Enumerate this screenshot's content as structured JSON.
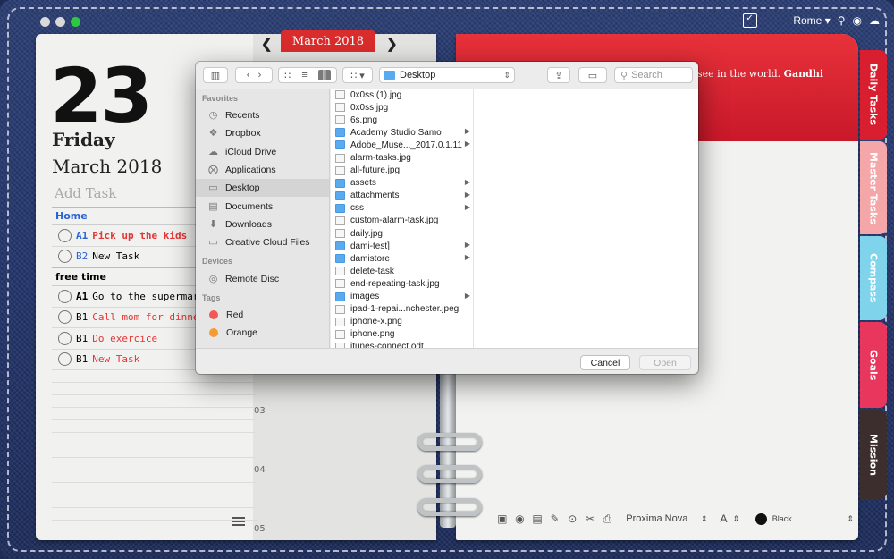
{
  "colors": {
    "accent_red": "#d92c2c",
    "home_blue": "#2864d4",
    "task_red": "#e53534"
  },
  "topbar": {
    "city": "Rome ▾",
    "icons": [
      "calendar-check-icon",
      "search-icon",
      "eye-icon",
      "cloud-icon"
    ]
  },
  "planner": {
    "day_number": "23",
    "weekday": "Friday",
    "month_year": "March 2018",
    "add_task_placeholder": "Add Task",
    "month_tab": "March 2018",
    "sections": [
      {
        "title": "Home",
        "tasks": [
          {
            "priority": "A1",
            "text": "Pick up the kids",
            "red": true
          },
          {
            "priority": "B2",
            "text": "New Task",
            "red": false
          }
        ]
      },
      {
        "title": "free time",
        "tasks": [
          {
            "priority": "A1",
            "text": "Go to the supermarke",
            "red": false
          },
          {
            "priority": "B1",
            "text": "Call mom for dinner",
            "red": true
          },
          {
            "priority": "B1",
            "text": "Do exercice",
            "red": true
          },
          {
            "priority": "B1",
            "text": "New Task",
            "red": true
          }
        ]
      }
    ],
    "hours": [
      "03",
      "04",
      "05"
    ]
  },
  "right_page": {
    "quote": "see in the world.",
    "quote_author": "Gandhi",
    "tabs": [
      "Daily Tasks",
      "Master Tasks",
      "Compass",
      "Goals",
      "Mission"
    ],
    "font_name": "Proxima Nova",
    "font_size_label": "A",
    "color_name": "Black"
  },
  "dialog": {
    "location": "Desktop",
    "search_placeholder": "Search",
    "sidebar": {
      "favorites_header": "Favorites",
      "favorites": [
        {
          "label": "Recents",
          "icon": "clock-icon"
        },
        {
          "label": "Dropbox",
          "icon": "dropbox-icon"
        },
        {
          "label": "iCloud Drive",
          "icon": "cloud-icon"
        },
        {
          "label": "Applications",
          "icon": "applications-icon"
        },
        {
          "label": "Desktop",
          "icon": "desktop-icon",
          "selected": true
        },
        {
          "label": "Documents",
          "icon": "document-icon"
        },
        {
          "label": "Downloads",
          "icon": "download-icon"
        },
        {
          "label": "Creative Cloud Files",
          "icon": "folder-icon"
        }
      ],
      "devices_header": "Devices",
      "devices": [
        {
          "label": "Remote Disc",
          "icon": "disc-icon"
        }
      ],
      "tags_header": "Tags",
      "tags": [
        {
          "label": "Red",
          "color": "#ef5a55"
        },
        {
          "label": "Orange",
          "color": "#f49b34"
        }
      ]
    },
    "files": [
      {
        "name": "0x0ss (1).jpg",
        "type": "image"
      },
      {
        "name": "0x0ss.jpg",
        "type": "image"
      },
      {
        "name": "6s.png",
        "type": "image"
      },
      {
        "name": "Academy Studio Samo",
        "type": "folder"
      },
      {
        "name": "Adobe_Muse..._2017.0.1.11",
        "type": "folder"
      },
      {
        "name": "alarm-tasks.jpg",
        "type": "image"
      },
      {
        "name": "all-future.jpg",
        "type": "image"
      },
      {
        "name": "assets",
        "type": "folder"
      },
      {
        "name": "attachments",
        "type": "folder"
      },
      {
        "name": "css",
        "type": "folder"
      },
      {
        "name": "custom-alarm-task.jpg",
        "type": "image"
      },
      {
        "name": "daily.jpg",
        "type": "image"
      },
      {
        "name": "dami-test]",
        "type": "folder"
      },
      {
        "name": "damistore",
        "type": "folder"
      },
      {
        "name": "delete-task",
        "type": "file"
      },
      {
        "name": "end-repeating-task.jpg",
        "type": "image"
      },
      {
        "name": "images",
        "type": "folder"
      },
      {
        "name": "ipad-1-repai...nchester.jpeg",
        "type": "image"
      },
      {
        "name": "iphone-x.png",
        "type": "image"
      },
      {
        "name": "iphone.png",
        "type": "image"
      },
      {
        "name": "itunes-connect.odt",
        "type": "file"
      }
    ],
    "cancel_label": "Cancel",
    "open_label": "Open"
  }
}
